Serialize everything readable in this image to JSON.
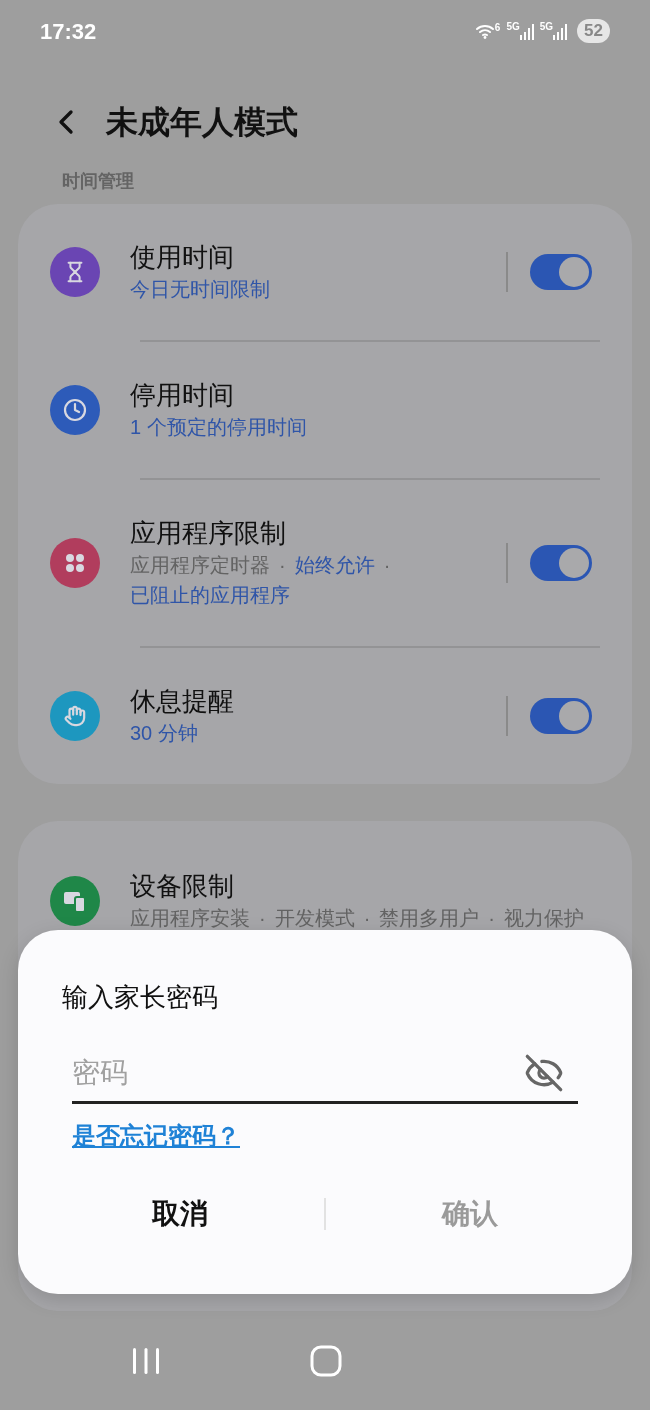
{
  "status_bar": {
    "time": "17:32",
    "wifi_badge": "6",
    "signals": [
      "5G",
      "5G"
    ],
    "battery": "52"
  },
  "header": {
    "title": "未成年人模式"
  },
  "section_label": "时间管理",
  "time_items": [
    {
      "title": "使用时间",
      "kind": "hourglass",
      "color": "#6a45b3",
      "switch": {
        "on": true
      },
      "lines": [
        [
          {
            "text": "今日无时间限制",
            "kind": "link"
          }
        ]
      ]
    },
    {
      "title": "停用时间",
      "kind": "clock",
      "color": "#2d5bb9",
      "lines": [
        [
          {
            "text": "1 个预定的停用时间",
            "kind": "link"
          }
        ]
      ]
    },
    {
      "title": "应用程序限制",
      "kind": "dots",
      "color": "#b13d5d",
      "switch": {
        "on": true
      },
      "lines": [
        [
          {
            "text": "应用程序定时器",
            "kind": "plain"
          },
          {
            "text": "·",
            "kind": "plain"
          },
          {
            "text": "始终允许",
            "kind": "link"
          },
          {
            "text": "·",
            "kind": "plain"
          }
        ],
        [
          {
            "text": "已阻止的应用程序",
            "kind": "link"
          }
        ]
      ]
    },
    {
      "title": "休息提醒",
      "kind": "hand",
      "color": "#1d97bf",
      "switch": {
        "on": true
      },
      "lines": [
        [
          {
            "text": "30 分钟",
            "kind": "link"
          }
        ]
      ]
    }
  ],
  "device_items": [
    {
      "title": "设备限制",
      "kind": "devices",
      "color": "#1f8748",
      "lines": [
        [
          {
            "text": "应用程序安装",
            "kind": "plain"
          },
          {
            "text": "·",
            "kind": "plain"
          },
          {
            "text": "开发模式",
            "kind": "plain"
          },
          {
            "text": "·",
            "kind": "plain"
          },
          {
            "text": "禁用多用户",
            "kind": "plain"
          },
          {
            "text": "·",
            "kind": "plain"
          },
          {
            "text": "视力保护",
            "kind": "plain"
          }
        ]
      ]
    }
  ],
  "dialog": {
    "title": "输入家长密码",
    "password": {
      "placeholder": "密码"
    },
    "forgot_link": "是否忘记密码？",
    "buttons": [
      {
        "label": "取消",
        "disabled": false
      },
      {
        "label": "确认",
        "disabled": true
      }
    ]
  }
}
